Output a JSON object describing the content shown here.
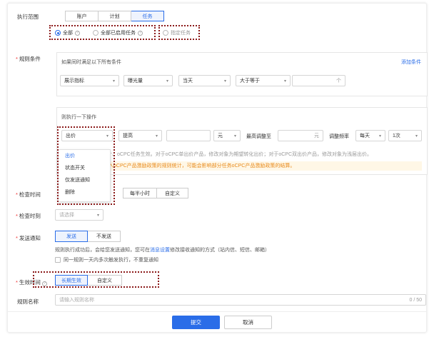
{
  "scope": {
    "label": "执行范围",
    "tabs": [
      "账户",
      "计划",
      "任务"
    ],
    "active_tab": 2,
    "options": [
      "全部",
      "全部已启用任务",
      "指定任务"
    ]
  },
  "rules": {
    "label": "规则条件",
    "condition_title": "如果同时满足以下所有条件",
    "add_condition": "添加条件",
    "condition": {
      "metric_type": "展示指标",
      "metric": "曝光量",
      "period": "当天",
      "operator": "大于等于",
      "value_suffix": "个"
    },
    "action_title": "则执行一下操作",
    "action": {
      "type": "出价",
      "direction": "提高",
      "unit": "元",
      "max_label": "最高调整至",
      "max_suffix": "元",
      "freq_label": "调整频率",
      "freq_period": "每天",
      "freq_count": "1次"
    },
    "action_menu": [
      "出价",
      "状态开关",
      "仅发送通知",
      "删除"
    ],
    "hint_text": "计、oCPC任务生效。对于oCPC单出价产品，修改对象为期望转化出价；对于oCPC双出价产品，修改对象为浅层出价。",
    "warn_text": "入oCPC产品激励政策的规则统计，可能会影响部分任务oCPC产品激励政策的结算。"
  },
  "check_time": {
    "label": "检查时间",
    "options": [
      "每半小时",
      "自定义"
    ]
  },
  "check_moment": {
    "label": "检查时刻",
    "placeholder": "请选择"
  },
  "notify": {
    "label": "发送通知",
    "options": [
      "发送",
      "不发送"
    ],
    "desc_prefix": "规则执行成功后，会给您发送通知，您可在",
    "desc_link": "消息设置",
    "desc_suffix": "修改接收通知的方式（站内信、短信、邮箱）",
    "checkbox_label": "同一规则一天内多次触发执行，不重复通知"
  },
  "effective": {
    "label": "生效时间",
    "options": [
      "长期生效",
      "自定义"
    ]
  },
  "rule_name": {
    "label": "规则名称",
    "placeholder": "请输入规则名称",
    "counter": "0 / 50"
  },
  "footer": {
    "submit": "提交",
    "cancel": "取消"
  },
  "colors": {
    "primary": "#2a6de8",
    "annotation": "#8b1a1a",
    "warning": "#e88a1a",
    "required": "#e33333"
  }
}
